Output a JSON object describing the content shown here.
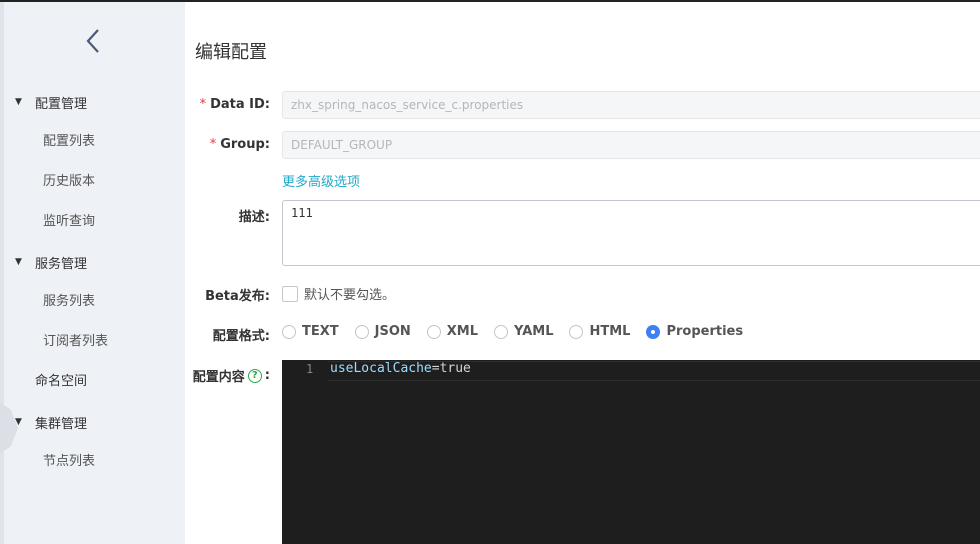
{
  "sidebar": {
    "back_icon": "chevron-left-icon",
    "groups": [
      {
        "label": "配置管理",
        "items": [
          "配置列表",
          "历史版本",
          "监听查询"
        ]
      },
      {
        "label": "服务管理",
        "items": [
          "服务列表",
          "订阅者列表"
        ]
      },
      {
        "label": "命名空间"
      },
      {
        "label": "集群管理",
        "items": [
          "节点列表"
        ]
      }
    ]
  },
  "page": {
    "title": "编辑配置"
  },
  "form": {
    "data_id": {
      "required": "*",
      "label": "Data ID:",
      "value": "zhx_spring_nacos_service_c.properties"
    },
    "group": {
      "required": "*",
      "label": "Group:",
      "value": "DEFAULT_GROUP"
    },
    "advanced_link": "更多高级选项",
    "description": {
      "label": "描述:",
      "value": "111"
    },
    "beta": {
      "label": "Beta发布:",
      "checkbox_text": "默认不要勾选。"
    },
    "format": {
      "label": "配置格式:",
      "options": [
        "TEXT",
        "JSON",
        "XML",
        "YAML",
        "HTML",
        "Properties"
      ],
      "selected": "Properties"
    },
    "content": {
      "label": "配置内容",
      "help_icon": "question-icon",
      "colon": ":",
      "line_number": "1",
      "code_key": "useLocalCache",
      "code_rest": "=true"
    }
  },
  "colors": {
    "accent": "#3f7ff6",
    "link": "#23a8c9",
    "required": "#e4393c",
    "editor_bg": "#1e1e1e"
  }
}
